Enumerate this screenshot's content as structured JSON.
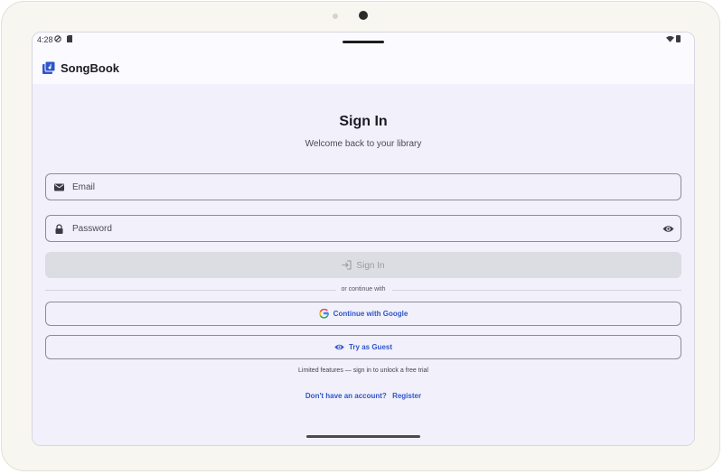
{
  "status_bar": {
    "time": "4:28"
  },
  "app": {
    "title": "SongBook",
    "logo_icon": "music-library-icon",
    "accent_color": "#2f56c9"
  },
  "signin": {
    "title": "Sign In",
    "subtitle": "Welcome back to your library",
    "email_placeholder": "Email",
    "password_placeholder": "Password",
    "submit_label": "Sign In",
    "divider_text": "or continue with",
    "google_label": "Continue with Google",
    "guest_label": "Try as Guest",
    "note": "Limited features — sign in to unlock a free trial",
    "register_prompt": "Don't have an account?",
    "register_link": "Register"
  }
}
